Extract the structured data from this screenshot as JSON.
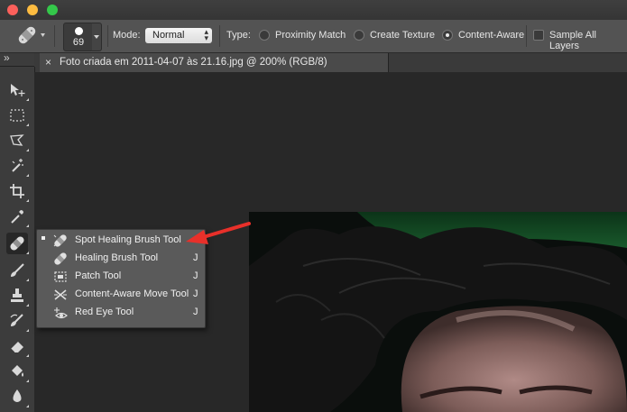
{
  "window": {
    "traffic_lights": {
      "close_color": "#fc605b",
      "minimize_color": "#fdbc40",
      "zoom_color": "#34c84a"
    }
  },
  "options_bar": {
    "brush_size": "69",
    "mode_label": "Mode:",
    "mode_value": "Normal",
    "type_label": "Type:",
    "type_options": [
      {
        "label": "Proximity Match",
        "selected": false
      },
      {
        "label": "Create Texture",
        "selected": false
      },
      {
        "label": "Content-Aware",
        "selected": true
      }
    ],
    "sample_all_layers": {
      "label": "Sample All Layers",
      "checked": false
    }
  },
  "document_tab": {
    "close_glyph": "×",
    "title": "Foto criada em 2011-04-07 às 21.16.jpg @ 200% (RGB/8)"
  },
  "toolbar": {
    "collapse_glyph": "»",
    "tools": [
      {
        "name": "move-tool",
        "icon": "move-icon"
      },
      {
        "name": "rectangular-marquee-tool",
        "icon": "marquee-icon"
      },
      {
        "name": "lasso-tool",
        "icon": "lasso-icon"
      },
      {
        "name": "magic-wand-tool",
        "icon": "magic-wand-icon"
      },
      {
        "name": "crop-tool",
        "icon": "crop-icon"
      },
      {
        "name": "eyedropper-tool",
        "icon": "eyedropper-icon"
      },
      {
        "name": "spot-healing-tool",
        "icon": "bandage-icon",
        "active": true
      },
      {
        "name": "brush-tool",
        "icon": "brush-icon"
      },
      {
        "name": "clone-stamp-tool",
        "icon": "stamp-icon"
      },
      {
        "name": "history-brush-tool",
        "icon": "history-brush-icon"
      },
      {
        "name": "eraser-tool",
        "icon": "eraser-icon"
      },
      {
        "name": "paint-bucket-tool",
        "icon": "bucket-icon"
      },
      {
        "name": "blur-tool",
        "icon": "blur-icon"
      }
    ]
  },
  "flyout_menu": {
    "items": [
      {
        "label": "Spot Healing Brush Tool",
        "shortcut": "J",
        "selected": true
      },
      {
        "label": "Healing Brush Tool",
        "shortcut": "J",
        "selected": false
      },
      {
        "label": "Patch Tool",
        "shortcut": "J",
        "selected": false
      },
      {
        "label": "Content-Aware Move Tool",
        "shortcut": "J",
        "selected": false
      },
      {
        "label": "Red Eye Tool",
        "shortcut": "J",
        "selected": false
      }
    ]
  },
  "annotation": {
    "arrow_color": "#e8302a"
  }
}
